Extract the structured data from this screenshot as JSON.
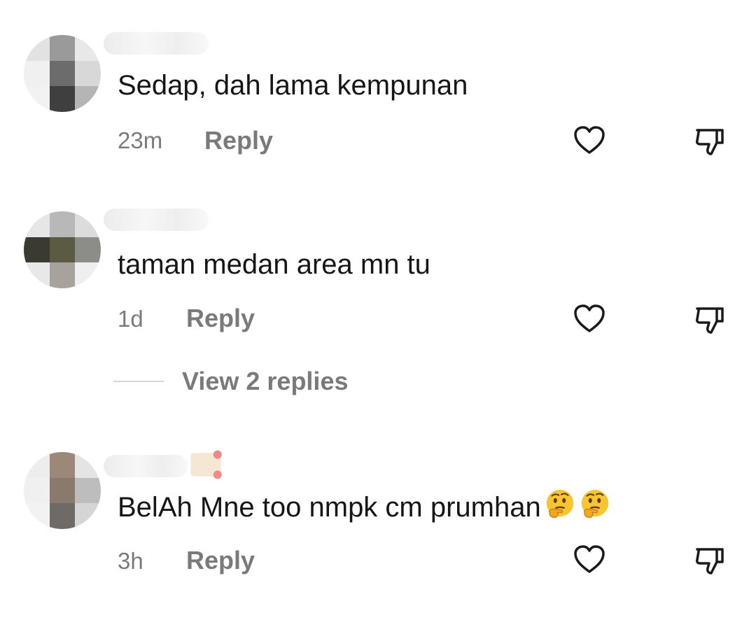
{
  "comments": [
    {
      "username": "",
      "text": "Sedap, dah lama kempunan",
      "time": "23m",
      "reply_label": "Reply"
    },
    {
      "username": "",
      "text": "taman medan area mn tu",
      "time": "1d",
      "reply_label": "Reply",
      "view_replies_label": "View 2 replies"
    },
    {
      "username": "",
      "text": "BelAh Mne too nmpk cm prumhan",
      "emojis": [
        "thinking-face",
        "thinking-face"
      ],
      "time": "3h",
      "reply_label": "Reply"
    }
  ],
  "icons": {
    "like": "heart-outline-icon",
    "dislike": "thumbs-down-outline-icon"
  },
  "colors": {
    "text": "#161616",
    "muted": "#7a7a7a",
    "icon_stroke": "#1a1a1a"
  }
}
